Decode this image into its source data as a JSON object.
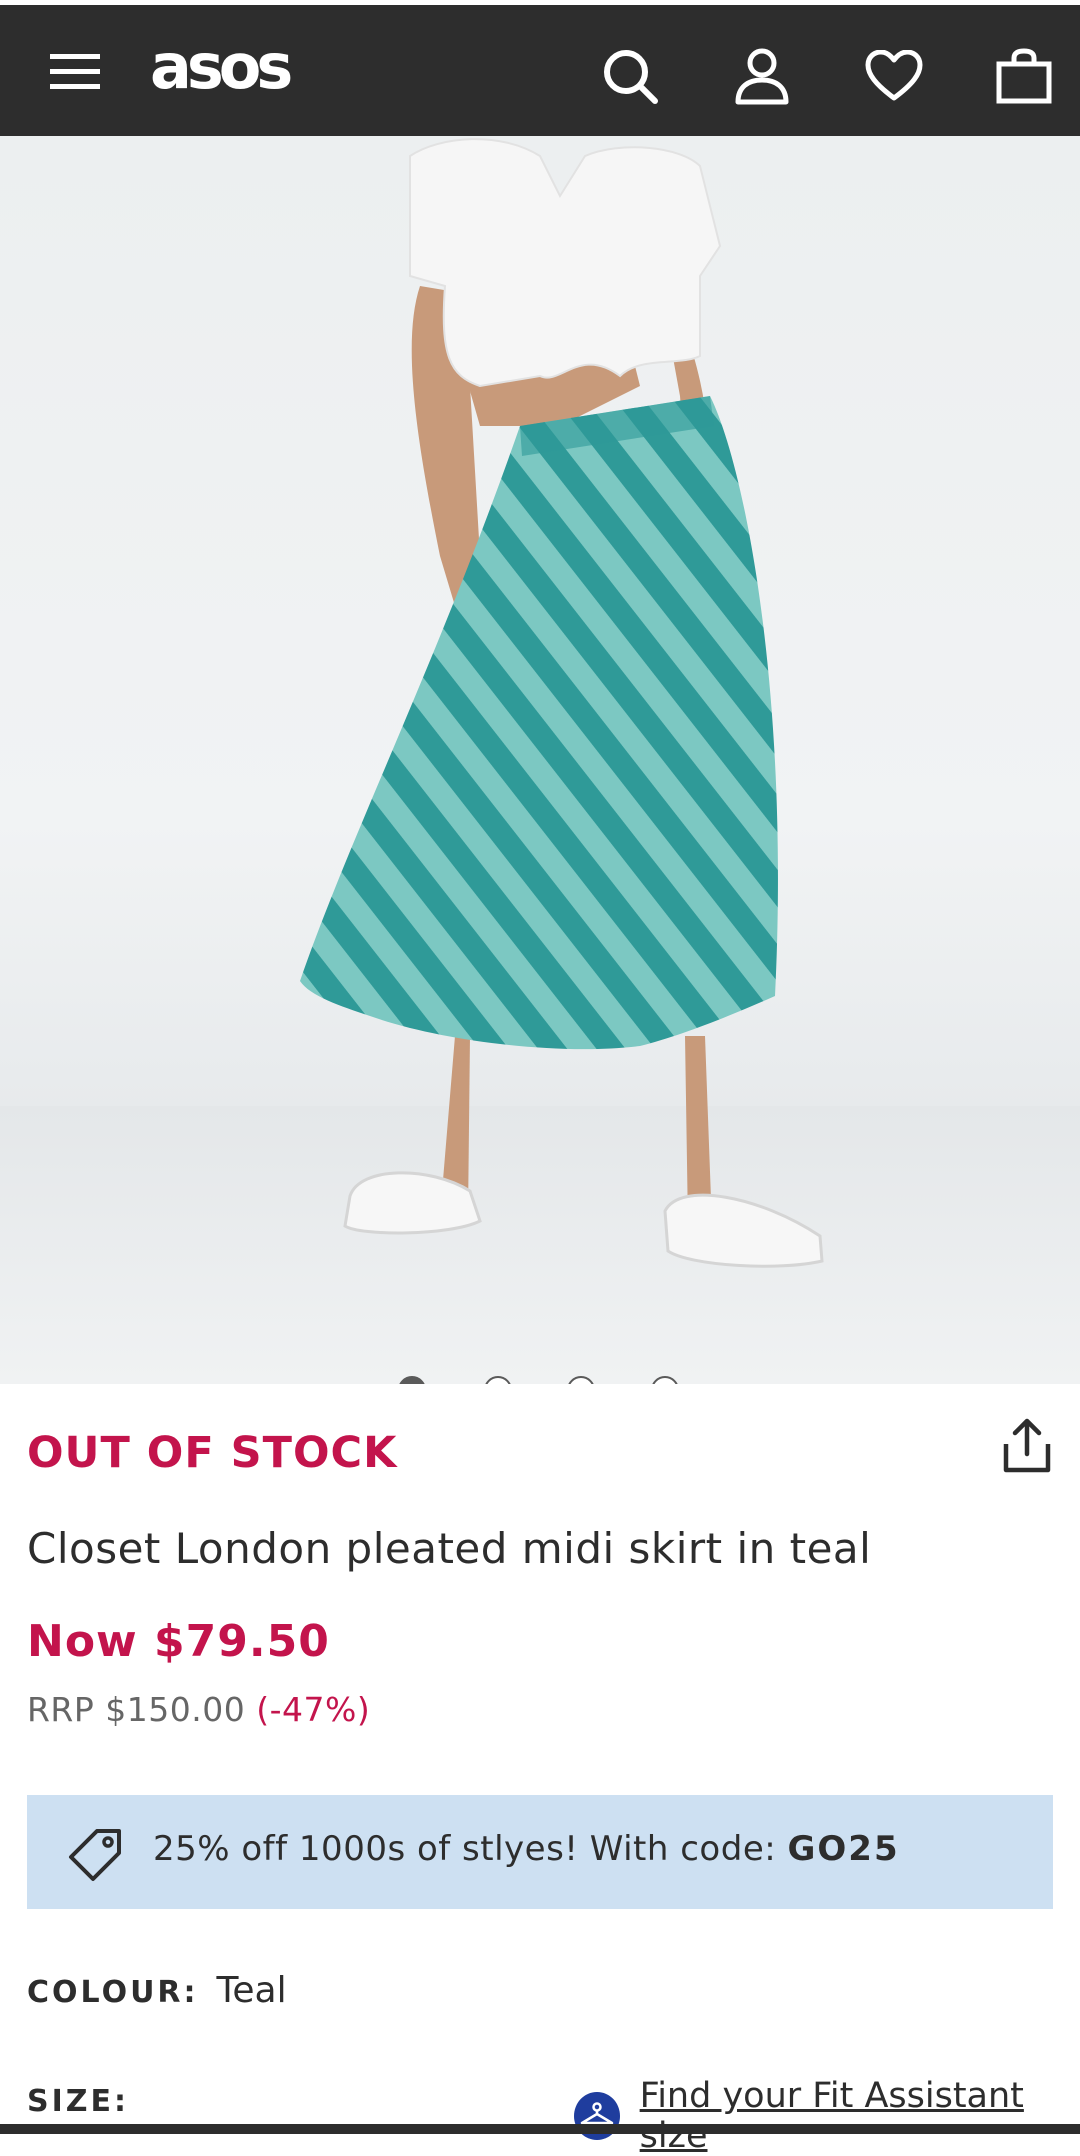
{
  "header": {
    "logo": "asos",
    "icons": [
      "menu-icon",
      "search-icon",
      "account-icon",
      "heart-icon",
      "bag-icon"
    ],
    "background": "#2d2d2d"
  },
  "gallery": {
    "image_count": 4,
    "active_index": 0
  },
  "product": {
    "stock_status": "OUT OF STOCK",
    "title": "Closet London pleated midi skirt in teal",
    "now_price": "Now $79.50",
    "rrp": "RRP $150.00",
    "discount": "(-47%)"
  },
  "promo": {
    "text": "25% off 1000s of stlyes! With code: ",
    "code": "GO25",
    "background": "#cde0f2"
  },
  "colour": {
    "label": "COLOUR:",
    "value": "Teal"
  },
  "size": {
    "label": "SIZE:",
    "fit_assistant_link": "Find your Fit Assistant size"
  },
  "colors": {
    "accent": "#c3144c",
    "text": "#2d2d2d"
  }
}
